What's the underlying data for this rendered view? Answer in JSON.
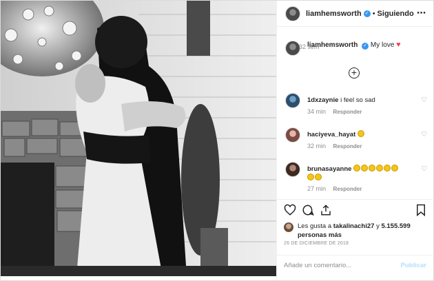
{
  "header": {
    "username": "liamhemsworth",
    "verified_mark": "✓",
    "separator": "•",
    "follow_status": "Siguiendo",
    "more_icon": "⋯"
  },
  "caption": {
    "username": "liamhemsworth",
    "text": "My love",
    "heart": "♥",
    "time": "32 sem"
  },
  "load_more_icon": "+",
  "comments": [
    {
      "username": "1dxzaynie",
      "text": "i feel so sad",
      "time": "34 min",
      "reply": "Responder",
      "emoji_count": 0
    },
    {
      "username": "haciyeva_hayat",
      "text": "",
      "time": "32 min",
      "reply": "Responder",
      "emoji_count": 1
    },
    {
      "username": "brunasayanne",
      "text": "",
      "time": "27 min",
      "reply": "Responder",
      "emoji_count": 7
    }
  ],
  "likes": {
    "prefix": "Les gusta a",
    "user": "takalinachi27",
    "suffix": "y",
    "count": "5.155.599",
    "count_suffix": "personas más"
  },
  "date": "26 DE DICIEMBRE DE 2018",
  "add_comment": {
    "placeholder": "Añade un comentario...",
    "publish": "Publicar"
  },
  "colors": {
    "link_blue": "#3897f0",
    "publish_disabled": "#b2dffc",
    "heart_red": "#ed4956",
    "muted_text": "#8e8e8e"
  }
}
